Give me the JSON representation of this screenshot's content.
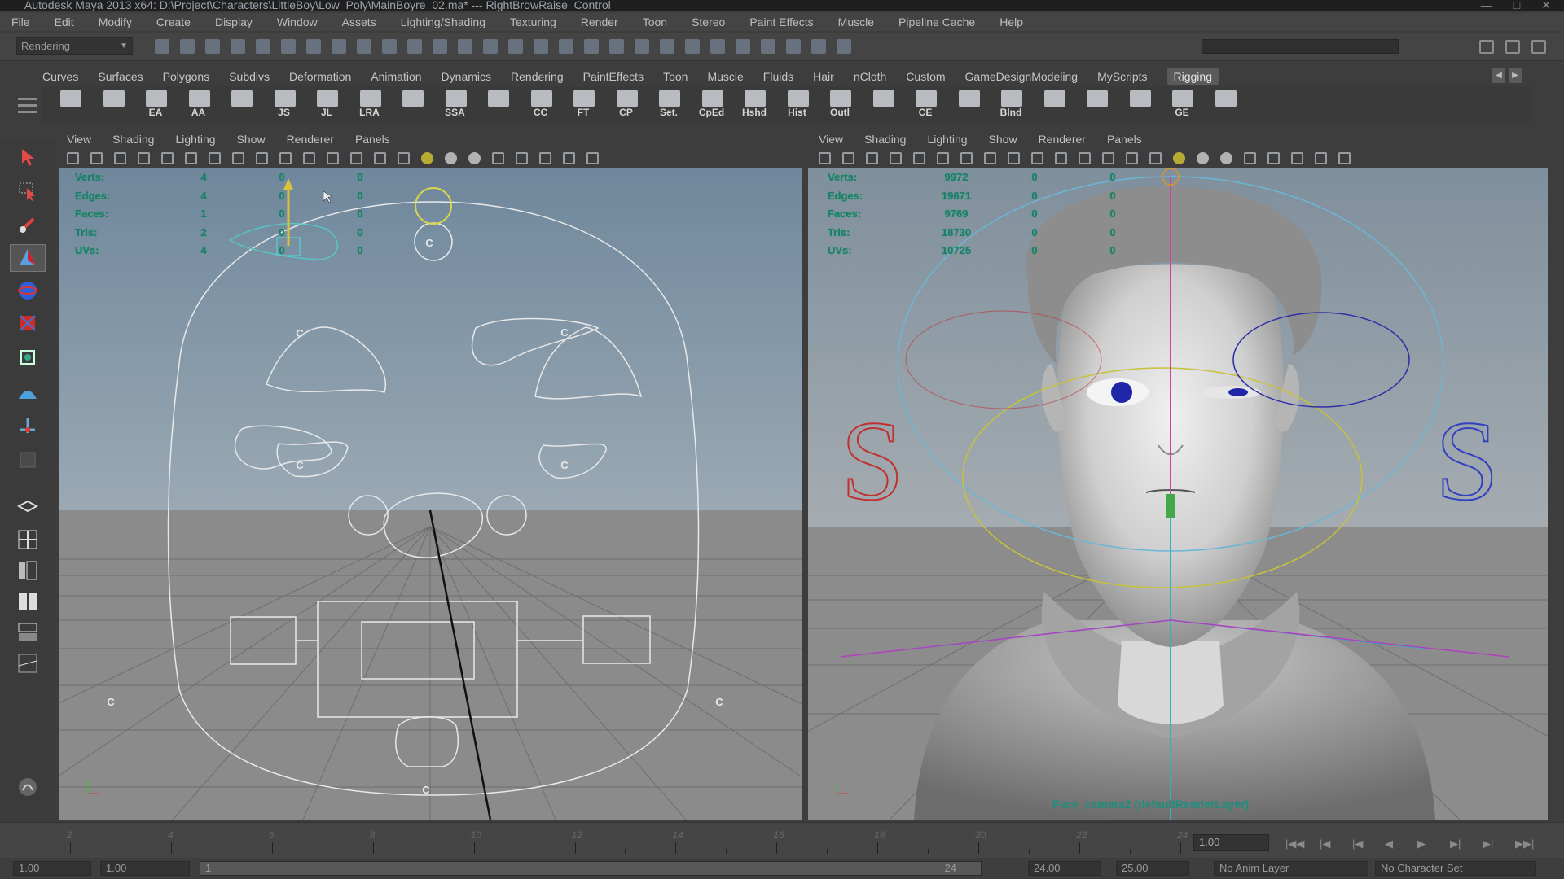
{
  "title_bar": {
    "text": "Autodesk Maya 2013 x64: D:\\Project\\Characters\\LittleBoy\\Low_Poly\\MainBoyre_02.ma*   ---   RightBrowRaise_Control"
  },
  "menu_bar": {
    "items": [
      "File",
      "Edit",
      "Modify",
      "Create",
      "Display",
      "Window",
      "Assets",
      "Lighting/Shading",
      "Texturing",
      "Render",
      "Toon",
      "Stereo",
      "Paint Effects",
      "Muscle",
      "Pipeline Cache",
      "Help"
    ]
  },
  "status_line": {
    "mode": "Rendering"
  },
  "shelf_tabs": [
    "Curves",
    "Surfaces",
    "Polygons",
    "Subdivs",
    "Deformation",
    "Animation",
    "Dynamics",
    "Rendering",
    "PaintEffects",
    "Toon",
    "Muscle",
    "Fluids",
    "Hair",
    "nCloth",
    "Custom",
    "GameDesignModeling",
    "MyScripts",
    "Rigging"
  ],
  "active_shelf_tab": "Rigging",
  "shelf_icons": [
    {
      "label": "",
      "icon": "joint-tool-icon"
    },
    {
      "label": "",
      "icon": "ik-handle-icon"
    },
    {
      "label": "EA",
      "icon": "edit-axis-icon"
    },
    {
      "label": "AA",
      "icon": "add-axis-icon"
    },
    {
      "label": "",
      "icon": "ik-spline-icon"
    },
    {
      "label": "JS",
      "icon": "joint-size-icon"
    },
    {
      "label": "JL",
      "icon": "joint-label-icon"
    },
    {
      "label": "LRA",
      "icon": "local-rotation-axis-icon"
    },
    {
      "label": "",
      "icon": "orient-joint-icon"
    },
    {
      "label": "SSA",
      "icon": "folder-icon"
    },
    {
      "label": "",
      "icon": "mirror-joint-icon"
    },
    {
      "label": "CC",
      "icon": "create-curve-icon"
    },
    {
      "label": "FT",
      "icon": "freeze-transform-icon"
    },
    {
      "label": "CP",
      "icon": "center-pivot-icon"
    },
    {
      "label": "Set.",
      "icon": "set-icon"
    },
    {
      "label": "CpEd",
      "icon": "component-editor-icon"
    },
    {
      "label": "Hshd",
      "icon": "hypershade-icon"
    },
    {
      "label": "Hist",
      "icon": "history-icon"
    },
    {
      "label": "Outl",
      "icon": "outliner-icon"
    },
    {
      "label": "",
      "icon": "blend-icon"
    },
    {
      "label": "CE",
      "icon": "connection-editor-icon"
    },
    {
      "label": "",
      "icon": "paint-weights-icon"
    },
    {
      "label": "Blnd",
      "icon": "blend-shape-icon"
    },
    {
      "label": "",
      "icon": "cluster-icon"
    },
    {
      "label": "",
      "icon": "wire-icon"
    },
    {
      "label": "",
      "icon": "lattice-icon"
    },
    {
      "label": "GE",
      "icon": "graph-editor-icon"
    },
    {
      "label": "",
      "icon": "constraint-icon"
    }
  ],
  "panel_menu": [
    "View",
    "Shading",
    "Lighting",
    "Show",
    "Renderer",
    "Panels"
  ],
  "left_viewport": {
    "hud": [
      {
        "label": "Verts:",
        "v1": "4",
        "v2": "0",
        "v3": "0"
      },
      {
        "label": "Edges:",
        "v1": "4",
        "v2": "0",
        "v3": "0"
      },
      {
        "label": "Faces:",
        "v1": "1",
        "v2": "0",
        "v3": "0"
      },
      {
        "label": "Tris:",
        "v1": "2",
        "v2": "0",
        "v3": "0"
      },
      {
        "label": "UVs:",
        "v1": "4",
        "v2": "0",
        "v3": "0"
      }
    ],
    "control_letter": "C"
  },
  "right_viewport": {
    "hud": [
      {
        "label": "Verts:",
        "v1": "9972",
        "v2": "0",
        "v3": "0"
      },
      {
        "label": "Edges:",
        "v1": "19671",
        "v2": "0",
        "v3": "0"
      },
      {
        "label": "Faces:",
        "v1": "9769",
        "v2": "0",
        "v3": "0"
      },
      {
        "label": "Tris:",
        "v1": "18730",
        "v2": "0",
        "v3": "0"
      },
      {
        "label": "UVs:",
        "v1": "10725",
        "v2": "0",
        "v3": "0"
      }
    ],
    "camera_label": "Face_camera2 (defaultRenderLayer)",
    "side_letter": "S"
  },
  "timeline": {
    "ticks": [
      "2",
      "4",
      "6",
      "8",
      "10",
      "12",
      "14",
      "16",
      "18",
      "20",
      "22",
      "24"
    ],
    "current_frame": "1.00"
  },
  "range_bar": {
    "start_time": "1.00",
    "start_range": "1.00",
    "range_value": "1",
    "range_end_inner": "24",
    "end_range": "24.00",
    "end_time": "25.00",
    "anim_layer": "No Anim Layer",
    "character_set": "No Character Set"
  },
  "colors": {
    "viewport_sky": "#7d95ab",
    "viewport_ground": "#8a8a8a",
    "hud_text": "#1e7b78",
    "curve_white": "#e8e8e8",
    "selected_curve": "#56c6c8",
    "ring_cyan": "#6ab7d6",
    "ring_yellow": "#c8c23a",
    "ring_blue": "#2d2fa6",
    "ring_red": "#c03030"
  }
}
